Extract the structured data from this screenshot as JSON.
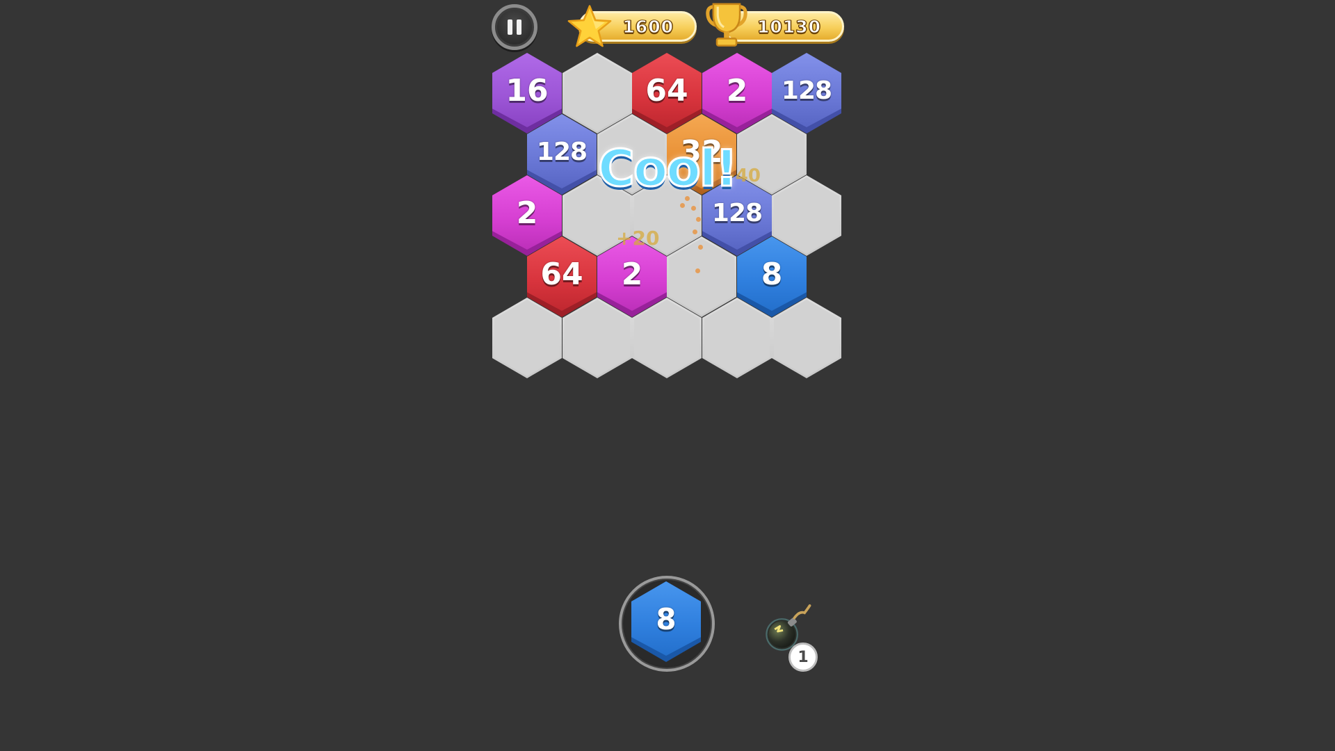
{
  "hud": {
    "stars": "1600",
    "best_score": "10130",
    "icons": [
      "pause-icon",
      "star-icon",
      "trophy-icon"
    ]
  },
  "board": {
    "row1": [
      "16",
      "",
      "64",
      "2",
      "128"
    ],
    "row2": [
      "128",
      "",
      "32",
      ""
    ],
    "row3": [
      "2",
      "",
      "",
      "128",
      ""
    ],
    "row4": [
      "64",
      "2",
      "",
      "8"
    ],
    "row5": [
      "",
      "",
      "",
      "",
      ""
    ]
  },
  "combo": {
    "text": "Cool!",
    "score_popup": "+20",
    "score_popup_2": "+40"
  },
  "next_tile": {
    "value": "8"
  },
  "powerups": {
    "bomb_count": "1",
    "icon": "bomb-icon"
  },
  "colors": {
    "background": "#353535",
    "tile_2": "#d63fd2",
    "tile_8": "#2f7fde",
    "tile_16": "#9c55d6",
    "tile_32": "#e89136",
    "tile_64": "#d8343d",
    "tile_128": "#6a78d6",
    "empty_cell": "#d2d2d2"
  }
}
